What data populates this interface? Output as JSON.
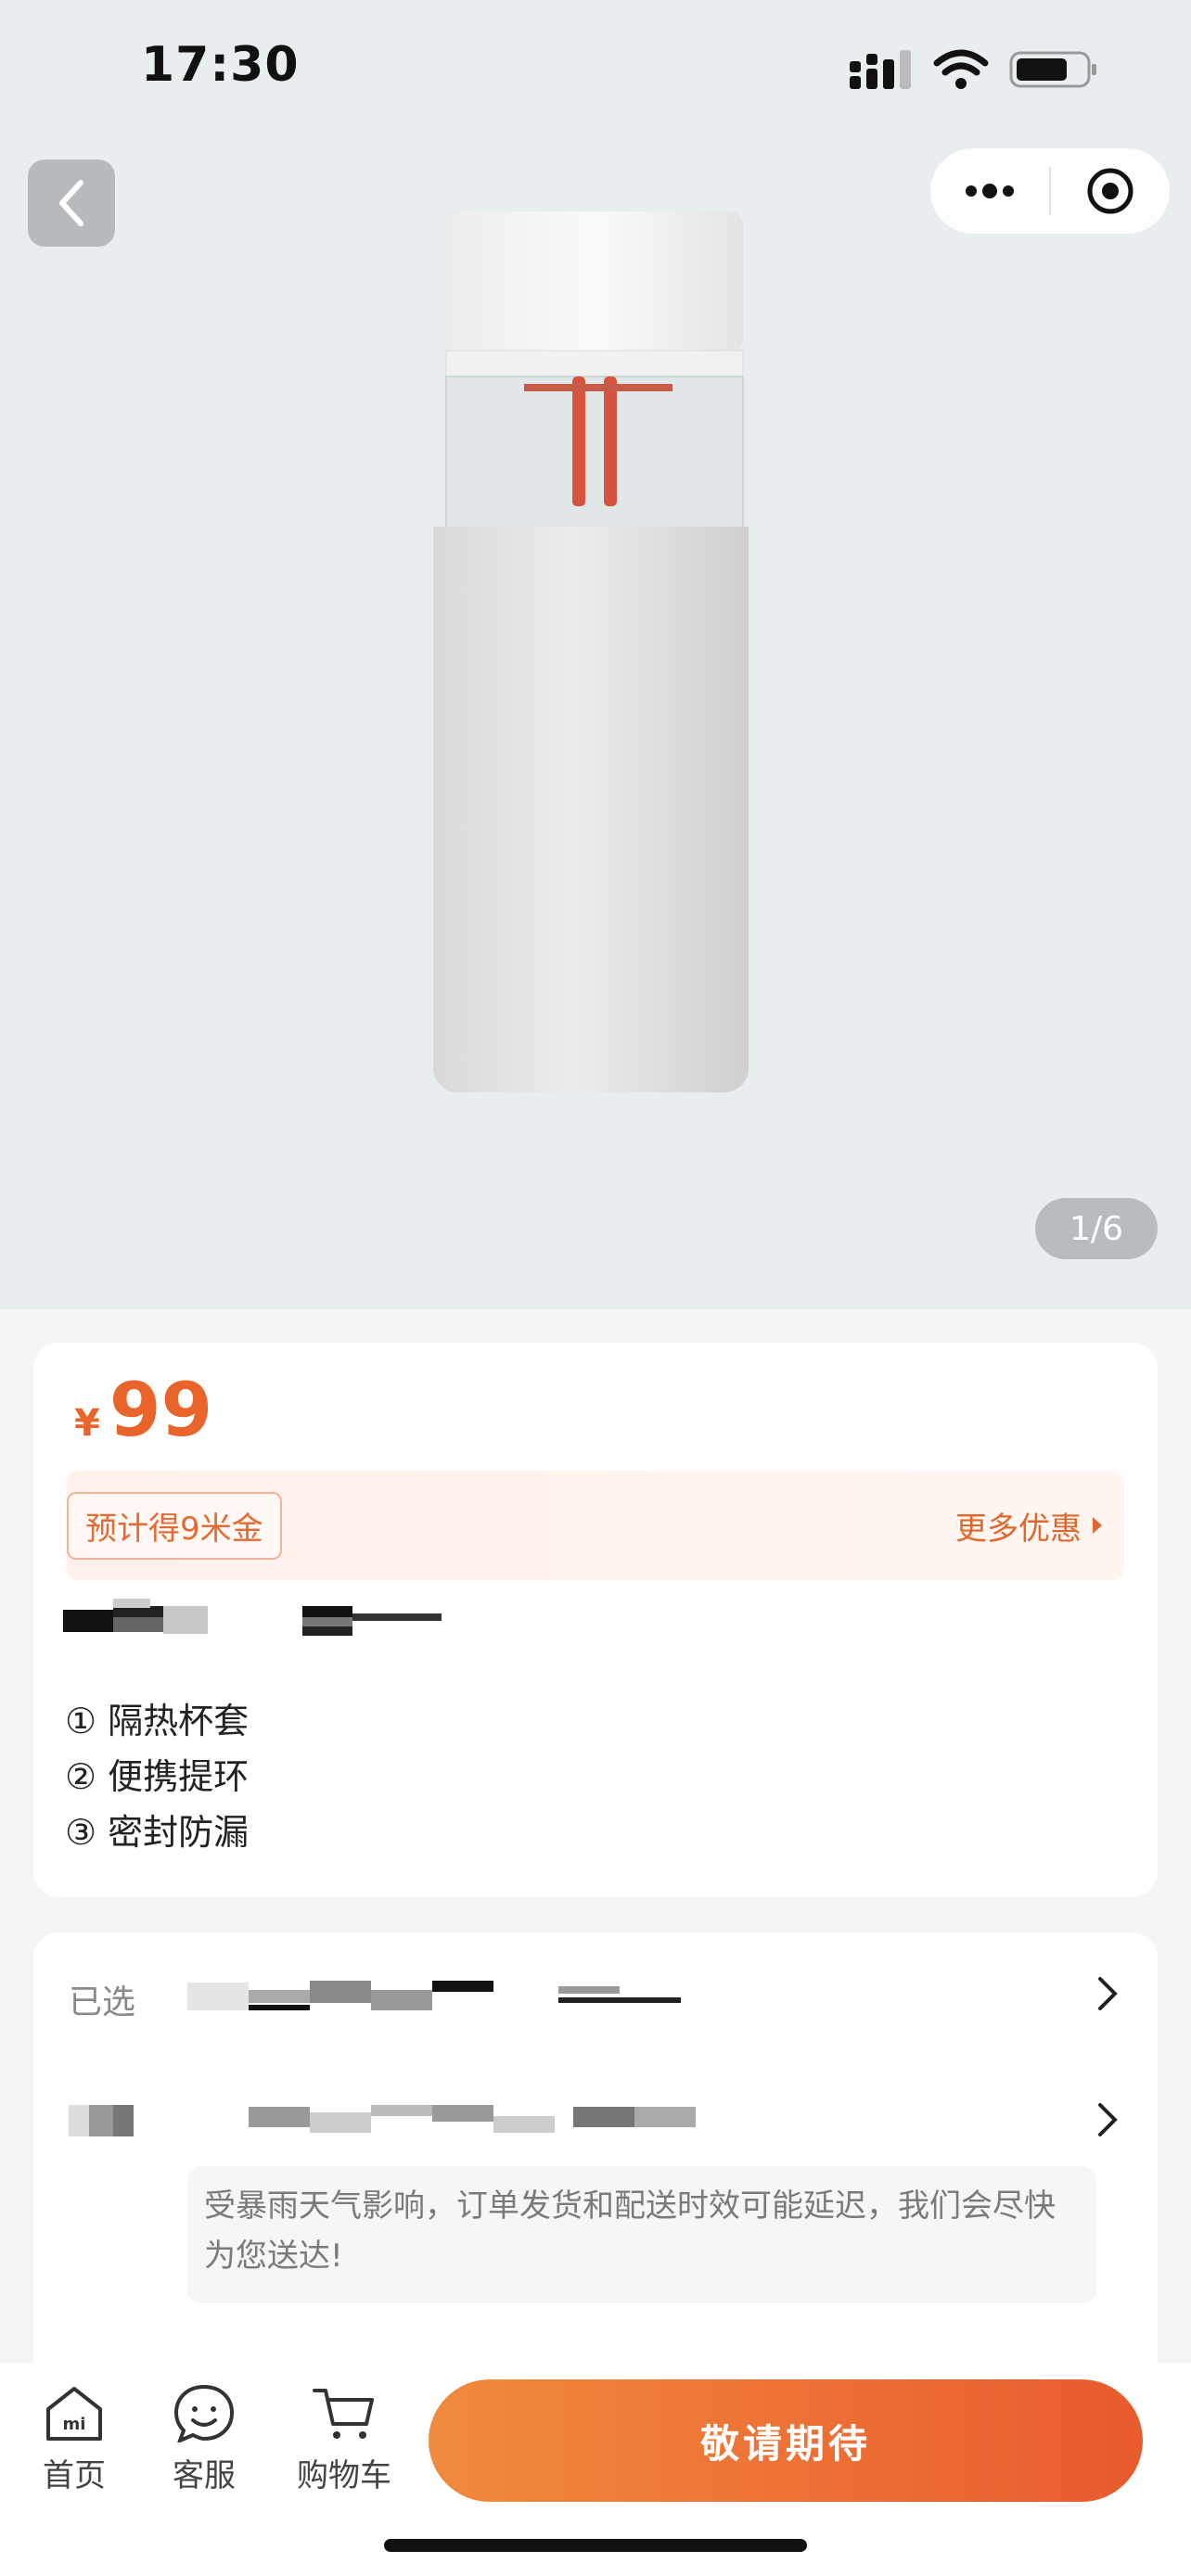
{
  "status": {
    "time": "17:30"
  },
  "gallery": {
    "counter": "1/6"
  },
  "price": {
    "currency": "¥",
    "amount": "99"
  },
  "promo": {
    "tag": "预计得9米金",
    "more": "更多优惠"
  },
  "features": [
    "① 隔热杯套",
    "② 便携提环",
    "③ 密封防漏"
  ],
  "selection": {
    "label": "已选"
  },
  "notice": {
    "text": "受暴雨天气影响，订单发货和配送时效可能延迟，我们会尽快为您送达!"
  },
  "tabbar": {
    "home": "首页",
    "service": "客服",
    "cart": "购物车",
    "action": "敬请期待"
  },
  "colors": {
    "accent": "#e8642a",
    "button_start": "#f08a3e",
    "button_end": "#e95a2d"
  }
}
